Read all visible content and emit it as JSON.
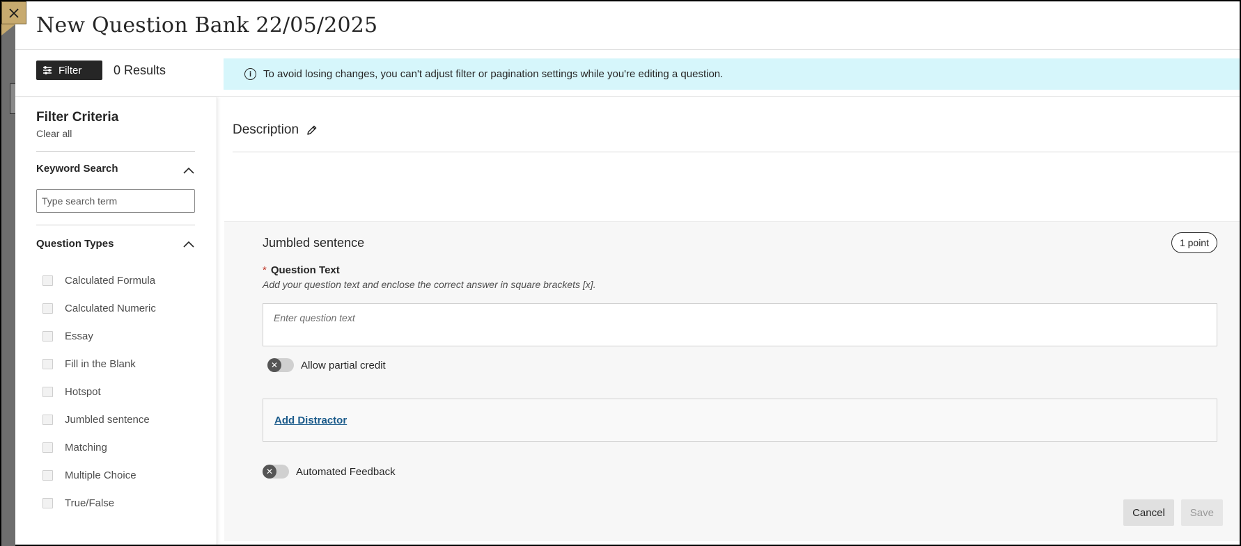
{
  "header": {
    "title": "New Question Bank 22/05/2025"
  },
  "toolbar": {
    "filter_label": "Filter",
    "results": "0 Results"
  },
  "banner": {
    "message": "To avoid losing changes, you can't adjust filter or pagination settings while you're editing a question.",
    "info_glyph": "i"
  },
  "sidebar": {
    "title": "Filter Criteria",
    "clear_all": "Clear all",
    "keyword": {
      "heading": "Keyword Search",
      "placeholder": "Type search term"
    },
    "question_types": {
      "heading": "Question Types",
      "items": [
        {
          "label": "Calculated Formula",
          "checked": false
        },
        {
          "label": "Calculated Numeric",
          "checked": false
        },
        {
          "label": "Essay",
          "checked": false
        },
        {
          "label": "Fill in the Blank",
          "checked": false
        },
        {
          "label": "Hotspot",
          "checked": false
        },
        {
          "label": "Jumbled sentence",
          "checked": false
        },
        {
          "label": "Matching",
          "checked": false
        },
        {
          "label": "Multiple Choice",
          "checked": false
        },
        {
          "label": "True/False",
          "checked": false
        }
      ]
    }
  },
  "main": {
    "description_label": "Description",
    "question": {
      "type_title": "Jumbled sentence",
      "points": "1 point",
      "text_label": "Question Text",
      "required_mark": "*",
      "text_hint": "Add your question text and enclose the correct answer in square brackets [x].",
      "text_placeholder": "Enter question text",
      "partial_credit_label": "Allow partial credit",
      "partial_credit_on": false,
      "add_distractor": "Add Distractor",
      "automated_feedback_label": "Automated Feedback",
      "automated_feedback_on": false,
      "toggle_off_glyph": "✕"
    },
    "buttons": {
      "cancel": "Cancel",
      "save": "Save"
    }
  },
  "colors": {
    "accent": "#c7aa6f",
    "banner_bg": "#d6f6fb",
    "link": "#1a5a8a",
    "dark": "#262626"
  }
}
